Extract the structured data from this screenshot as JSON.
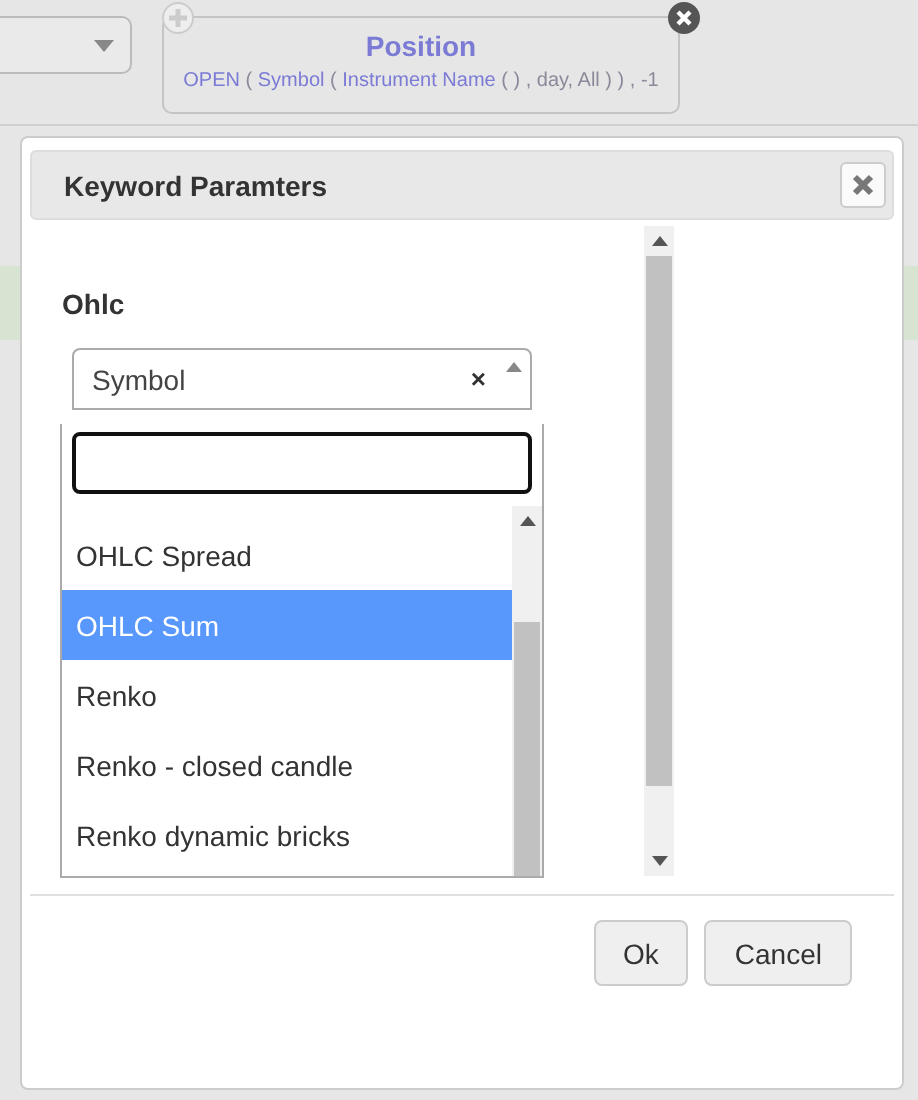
{
  "position_card": {
    "title": "Position",
    "expression": [
      {
        "text": "OPEN",
        "kind": "name"
      },
      {
        "text": " ( ",
        "kind": "punct"
      },
      {
        "text": "Symbol",
        "kind": "name"
      },
      {
        "text": " ( ",
        "kind": "punct"
      },
      {
        "text": "Instrument Name",
        "kind": "name"
      },
      {
        "text": " ( ) , day, All ) ) , -1",
        "kind": "punct"
      }
    ]
  },
  "dialog": {
    "title": "Keyword Paramters",
    "field_label": "Ohlc",
    "select": {
      "value": "Symbol",
      "clear": "×",
      "expanded": true
    },
    "options": [
      {
        "label": "OHLC Spread",
        "selected": false
      },
      {
        "label": "OHLC Sum",
        "selected": true
      },
      {
        "label": "Renko",
        "selected": false
      },
      {
        "label": "Renko - closed candle",
        "selected": false
      },
      {
        "label": "Renko dynamic bricks",
        "selected": false
      }
    ],
    "buttons": [
      "Ok",
      "Cancel"
    ]
  }
}
